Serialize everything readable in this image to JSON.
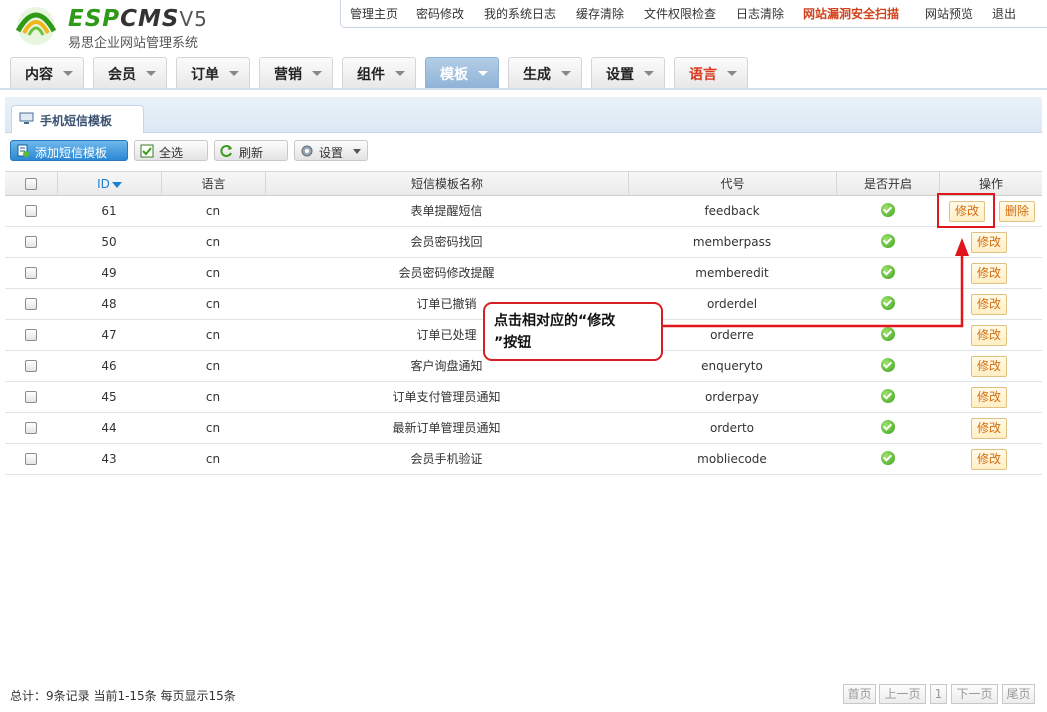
{
  "logo": {
    "brand_a": "ESP",
    "brand_b": "CMS",
    "brand_c": "V5",
    "subtitle": "易思企业网站管理系统"
  },
  "toplinks": [
    "管理主页",
    "密码修改",
    "我的系统日志",
    "缓存清除",
    "文件权限检查",
    "日志清除",
    "网站漏洞安全扫描",
    "网站预览",
    "退出"
  ],
  "nav": [
    "内容",
    "会员",
    "订单",
    "营销",
    "组件",
    "模板",
    "生成",
    "设置",
    "语言"
  ],
  "nav_active": "模板",
  "panel_tab": "手机短信模板",
  "toolbar": {
    "add": "添加短信模板",
    "select_all": "全选",
    "refresh": "刷新",
    "settings": "设置"
  },
  "table": {
    "headers": [
      "ID",
      "语言",
      "短信模板名称",
      "代号",
      "是否开启",
      "操作"
    ],
    "rows": [
      {
        "id": "61",
        "lang": "cn",
        "name": "表单提醒短信",
        "code": "feedback",
        "enabled": true,
        "actions": [
          "修改",
          "删除"
        ]
      },
      {
        "id": "50",
        "lang": "cn",
        "name": "会员密码找回",
        "code": "memberpass",
        "enabled": true,
        "actions": [
          "修改"
        ]
      },
      {
        "id": "49",
        "lang": "cn",
        "name": "会员密码修改提醒",
        "code": "memberedit",
        "enabled": true,
        "actions": [
          "修改"
        ]
      },
      {
        "id": "48",
        "lang": "cn",
        "name": "订单已撤销",
        "code": "orderdel",
        "enabled": true,
        "actions": [
          "修改"
        ]
      },
      {
        "id": "47",
        "lang": "cn",
        "name": "订单已处理",
        "code": "orderre",
        "enabled": true,
        "actions": [
          "修改"
        ]
      },
      {
        "id": "46",
        "lang": "cn",
        "name": "客户询盘通知",
        "code": "enqueryto",
        "enabled": true,
        "actions": [
          "修改"
        ]
      },
      {
        "id": "45",
        "lang": "cn",
        "name": "订单支付管理员通知",
        "code": "orderpay",
        "enabled": true,
        "actions": [
          "修改"
        ]
      },
      {
        "id": "44",
        "lang": "cn",
        "name": "最新订单管理员通知",
        "code": "orderto",
        "enabled": true,
        "actions": [
          "修改"
        ]
      },
      {
        "id": "43",
        "lang": "cn",
        "name": "会员手机验证",
        "code": "mobliecode",
        "enabled": true,
        "actions": [
          "修改"
        ]
      }
    ]
  },
  "callout": {
    "line1": "点击相对应的“修改",
    "line2": "”按钮"
  },
  "footer": {
    "total": "总计：9条记录 当前1-15条 每页显示15条"
  },
  "pagination": [
    "首页",
    "上一页",
    "1",
    "下一页",
    "尾页"
  ],
  "colors": {
    "accent": "#2b88d4",
    "warn": "#d2421c",
    "callout": "#d51f25",
    "action_text": "#d26d12"
  }
}
